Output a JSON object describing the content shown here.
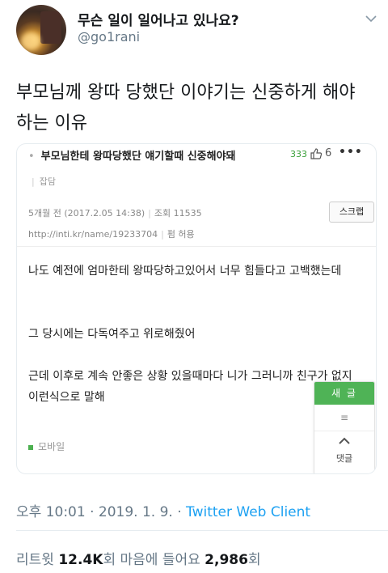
{
  "author": {
    "display_name": "무슨 일이 일어나고 있나요?",
    "handle": "@go1rani"
  },
  "tweet": {
    "text": "부모님께 왕따 당했단 이야기는 신중하게 해야 하는 이유"
  },
  "post": {
    "title": "부모님한테 왕따당했단 얘기할때 신중해야돼",
    "likes_count": "333",
    "thumb_count": "6",
    "category": "잡담",
    "meta_date": "5개월 전 (2017.2.05 14:38)",
    "meta_views": "조회 11535",
    "url": "http://inti.kr/name/19233704",
    "url_suffix": "펌 허용",
    "scrap_label": "스크랩",
    "body": [
      "나도 예전에 엄마한테 왕따당하고있어서 너무 힘들다고 고백했는데",
      "그 당시에는 다독여주고 위로해줬어",
      "근데 이후로 계속 안좋은 상황 있을때마다 니가 그러니까 친구가 없지 이런식으로 말해"
    ],
    "mobile_label": "모바일"
  },
  "float_panel": {
    "new_post": "새 글",
    "list": "≡",
    "comments": "댓글"
  },
  "footer": {
    "time": "오후 10:01 · 2019. 1. 9. · ",
    "source": "Twitter Web Client",
    "retweet_label": "리트윗 ",
    "retweet_count": "12.4K",
    "retweet_unit": "회 마음에 들어요 ",
    "like_count": "2,986",
    "like_unit": "회"
  },
  "colors": {
    "link_blue": "#1da1f2",
    "muted_gray": "#657786",
    "accent_green": "#4fb356"
  }
}
